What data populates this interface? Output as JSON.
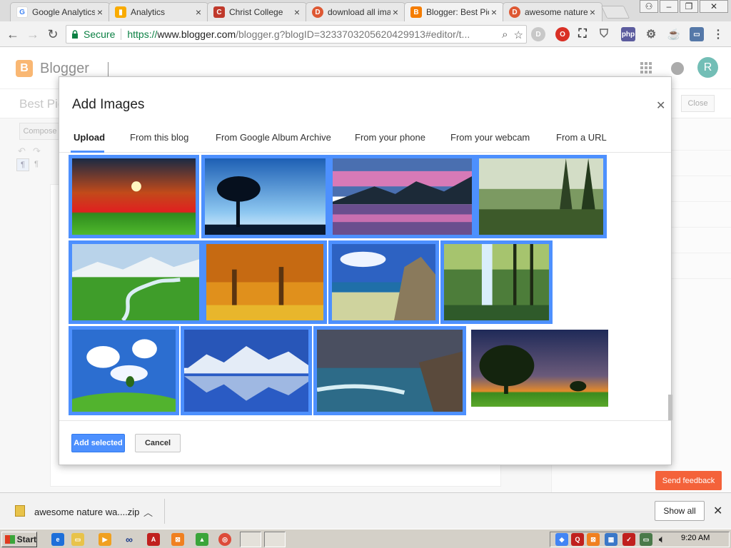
{
  "browser": {
    "tabs": [
      {
        "label": "Google Analytics",
        "icon": "google-icon",
        "color": "#4285f4"
      },
      {
        "label": "Analytics",
        "icon": "analytics-icon",
        "color": "#f9ab00"
      },
      {
        "label": "Christ College",
        "icon": "christ-college-icon",
        "color": "#c0392b"
      },
      {
        "label": "download all ima",
        "icon": "duckduckgo-icon",
        "color": "#de5833"
      },
      {
        "label": "Blogger: Best Pic",
        "icon": "blogger-icon",
        "color": "#f57d00"
      },
      {
        "label": "awesome nature",
        "icon": "duckduckgo-icon",
        "color": "#de5833"
      }
    ],
    "secure_label": "Secure",
    "url_scheme": "https://",
    "url_host": "www.blogger.com",
    "url_rest": "/blogger.g?blogID=3233703205620429913#editor/t..."
  },
  "blogger": {
    "brand": "Blogger",
    "avatar_letter": "R",
    "post_title": "Best Pic",
    "close_label": "Close",
    "compose_label": "Compose"
  },
  "dialog": {
    "title": "Add Images",
    "tabs": [
      "Upload",
      "From this blog",
      "From Google Album Archive",
      "From your phone",
      "From your webcam",
      "From a URL"
    ],
    "active_tab": "Upload",
    "add_selected_label": "Add selected",
    "cancel_label": "Cancel",
    "images": [
      {
        "name": "sunset-meadow",
        "selected": true
      },
      {
        "name": "tree-silhouette-blue-sky",
        "selected": true
      },
      {
        "name": "mountain-lake-pink-sky",
        "selected": true
      },
      {
        "name": "forest-garden",
        "selected": true
      },
      {
        "name": "green-valley-river",
        "selected": true
      },
      {
        "name": "autumn-trees",
        "selected": true
      },
      {
        "name": "rocky-beach",
        "selected": true
      },
      {
        "name": "forest-waterfall",
        "selected": true
      },
      {
        "name": "green-hill-clouds",
        "selected": true
      },
      {
        "name": "snow-mountain-reflection",
        "selected": true
      },
      {
        "name": "stormy-coast",
        "selected": true
      },
      {
        "name": "tree-sunset-field",
        "selected": false
      }
    ]
  },
  "feedback_label": "Send feedback",
  "downloads": {
    "file_name": "awesome nature wa....zip",
    "show_all_label": "Show all"
  },
  "taskbar": {
    "start_label": "Start",
    "clock": "9:20 AM"
  },
  "colors": {
    "accent": "#4d90fe",
    "blogger_orange": "#f57d00",
    "feedback": "#f4623a"
  }
}
